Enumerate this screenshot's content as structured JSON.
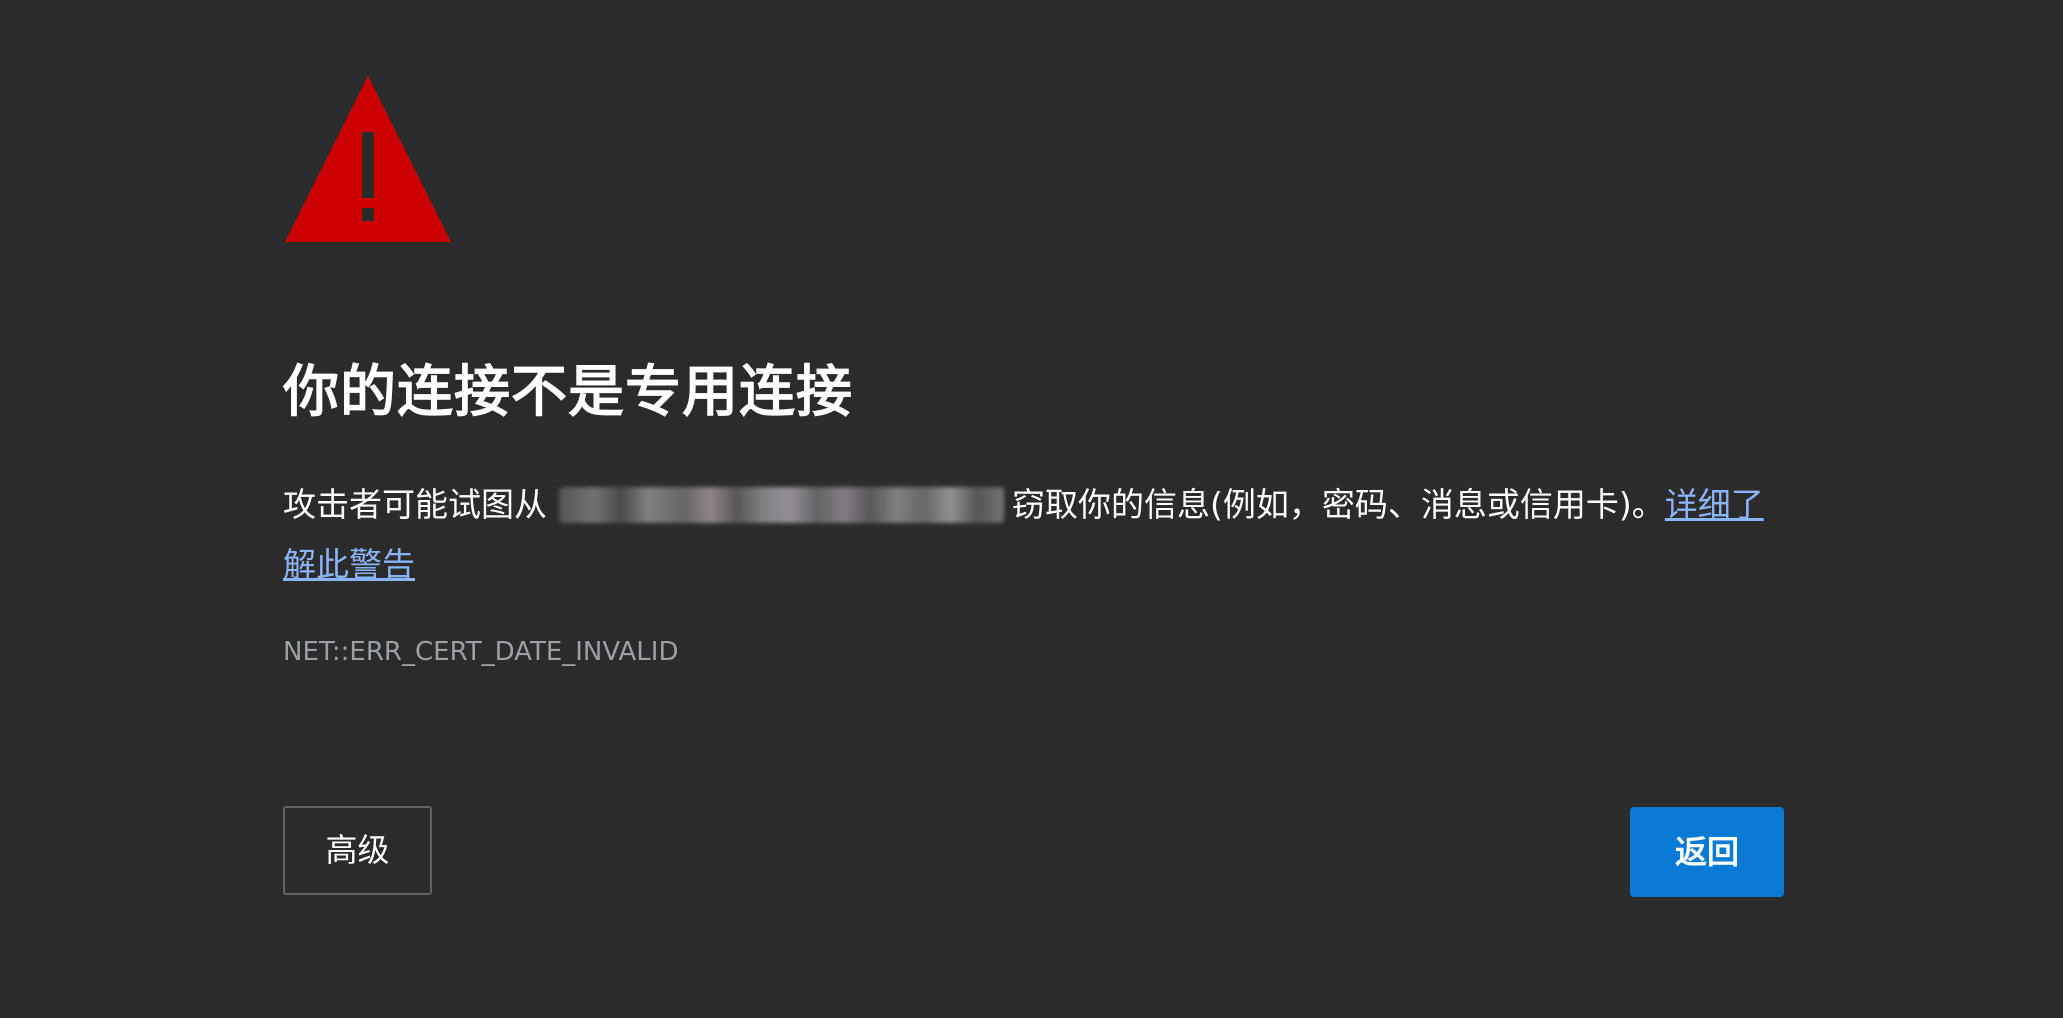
{
  "warning": {
    "icon": "warning-triangle-icon",
    "color": "#cc0000"
  },
  "title": "你的连接不是专用连接",
  "message": {
    "prefix": "攻击者可能试图从",
    "suffix": "窃取你的信息(例如，密码、消息或信用卡)。",
    "link": "详细了解此警告"
  },
  "error_code": "NET::ERR_CERT_DATE_INVALID",
  "buttons": {
    "advanced": "高级",
    "back": "返回"
  },
  "colors": {
    "background": "#2b2b2b",
    "link": "#8ab4f8",
    "primary_button": "#0a7ad4"
  }
}
